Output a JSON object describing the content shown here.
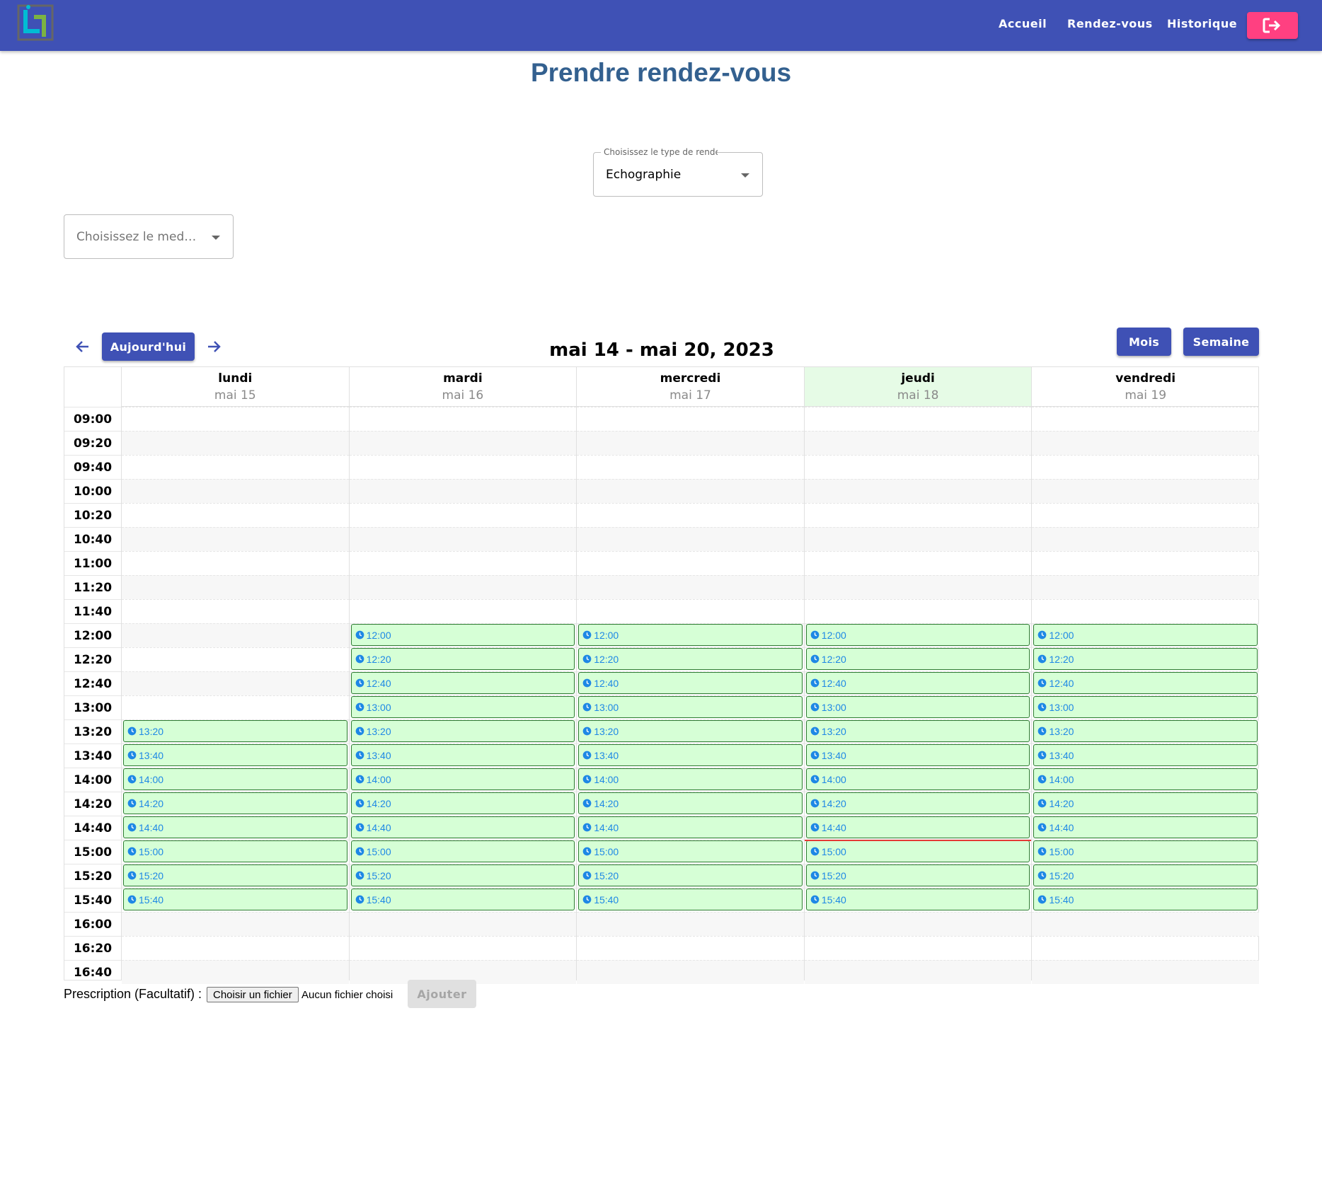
{
  "header": {
    "nav": [
      "Accueil",
      "Rendez-vous",
      "Historique"
    ],
    "logout_icon": "logout-icon"
  },
  "page": {
    "title": "Prendre rendez-vous"
  },
  "type_select": {
    "legend": "Choisissez le type de rendez-vous",
    "value": "Echographie"
  },
  "medecin_select": {
    "placeholder": "Choisissez le med…"
  },
  "calendar": {
    "today_button": "Aujourd'hui",
    "range_title": "mai 14 - mai 20, 2023",
    "view_buttons": [
      "Mois",
      "Semaine"
    ],
    "times": [
      "09:00",
      "09:20",
      "09:40",
      "10:00",
      "10:20",
      "10:40",
      "11:00",
      "11:20",
      "11:40",
      "12:00",
      "12:20",
      "12:40",
      "13:00",
      "13:20",
      "13:40",
      "14:00",
      "14:20",
      "14:40",
      "15:00",
      "15:20",
      "15:40",
      "16:00",
      "16:20",
      "16:40"
    ],
    "days": [
      {
        "name": "lundi",
        "date": "mai 15",
        "today": false,
        "slots": [
          "13:20",
          "13:40",
          "14:00",
          "14:20",
          "14:40",
          "15:00",
          "15:20",
          "15:40"
        ]
      },
      {
        "name": "mardi",
        "date": "mai 16",
        "today": false,
        "slots": [
          "12:00",
          "12:20",
          "12:40",
          "13:00",
          "13:20",
          "13:40",
          "14:00",
          "14:20",
          "14:40",
          "15:00",
          "15:20",
          "15:40"
        ]
      },
      {
        "name": "mercredi",
        "date": "mai 17",
        "today": false,
        "slots": [
          "12:00",
          "12:20",
          "12:40",
          "13:00",
          "13:20",
          "13:40",
          "14:00",
          "14:20",
          "14:40",
          "15:00",
          "15:20",
          "15:40"
        ]
      },
      {
        "name": "jeudi",
        "date": "mai 18",
        "today": true,
        "slots": [
          "12:00",
          "12:20",
          "12:40",
          "13:00",
          "13:20",
          "13:40",
          "14:00",
          "14:20",
          "14:40",
          "15:00",
          "15:20",
          "15:40"
        ]
      },
      {
        "name": "vendredi",
        "date": "mai 19",
        "today": false,
        "slots": [
          "12:00",
          "12:20",
          "12:40",
          "13:00",
          "13:20",
          "13:40",
          "14:00",
          "14:20",
          "14:40",
          "15:00",
          "15:20",
          "15:40"
        ]
      }
    ],
    "current_time": "15:00"
  },
  "prescription": {
    "label": "Prescription (Facultatif) :",
    "file_button": "Choisir un fichier",
    "no_file": "Aucun fichier choisi",
    "submit": "Ajouter"
  },
  "colors": {
    "primary": "#3f51b5",
    "accent": "#ff4081",
    "title": "#33608f",
    "slot_bg": "#d6ffd6",
    "slot_border": "#2e7d32",
    "slot_text": "#1e88e5",
    "today_bg": "#e6fbe6"
  }
}
